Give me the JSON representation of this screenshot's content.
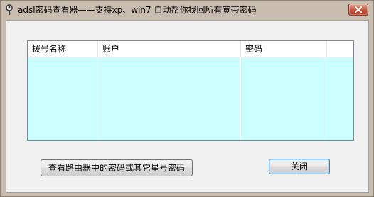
{
  "window": {
    "title": "adsl密码查看器——支持xp、win7 自动帮你找回所有宽带密码",
    "icon": "key-icon",
    "close_icon": "close-icon",
    "title_bg": "#c9bdb0",
    "close_color": "#c7533d"
  },
  "listview": {
    "columns": [
      "拨号名称",
      "账户",
      "密码",
      ""
    ],
    "rows": [],
    "body_color": "#ccffff"
  },
  "buttons": {
    "router_label": "查看路由器中的密码或其它星号密码",
    "close_label": "关闭"
  }
}
